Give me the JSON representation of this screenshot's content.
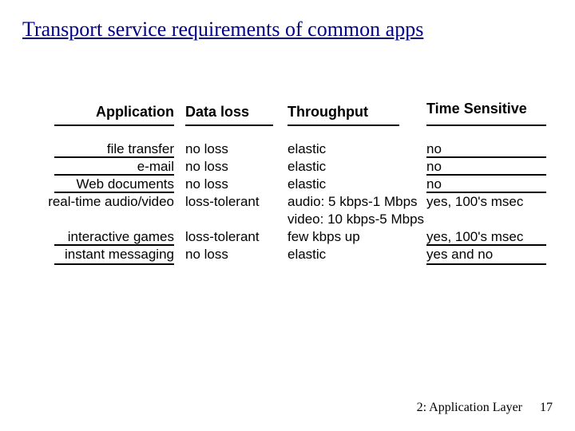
{
  "title": "Transport service requirements of common apps",
  "headers": {
    "application": "Application",
    "data_loss": "Data loss",
    "throughput": "Throughput",
    "time_sensitive": "Time Sensitive"
  },
  "rows": {
    "app": [
      "file transfer",
      "e-mail",
      "Web documents",
      "real-time audio/video",
      "",
      "interactive games",
      "instant messaging"
    ],
    "loss": [
      "no loss",
      "no loss",
      "no loss",
      "loss-tolerant",
      "",
      "loss-tolerant",
      "no loss"
    ],
    "throughput": [
      "elastic",
      "elastic",
      "elastic",
      "audio: 5 kbps-1 Mbps",
      "video: 10 kbps-5 Mbps",
      "few kbps up",
      "elastic"
    ],
    "time": [
      "no",
      "no",
      "no",
      "yes, 100's msec",
      "",
      "yes, 100's msec",
      "yes and no"
    ]
  },
  "footer": {
    "chapter": "2: Application Layer",
    "page": "17"
  }
}
